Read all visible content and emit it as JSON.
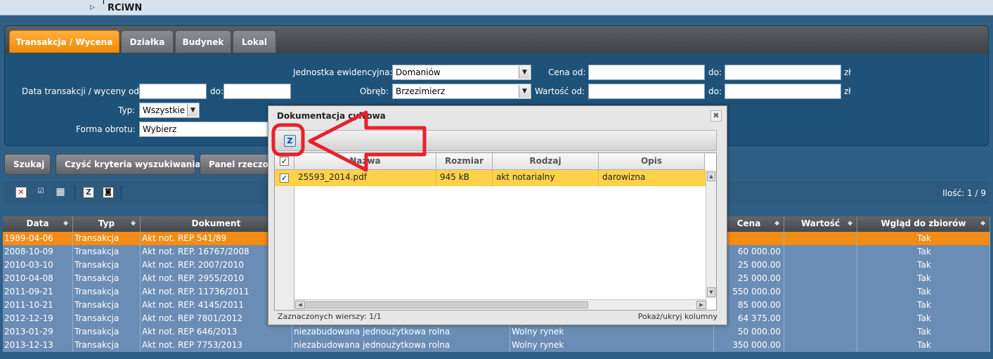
{
  "app": {
    "title": "RCiWN"
  },
  "tabs": [
    {
      "label": "Transakcja / Wycena",
      "active": true
    },
    {
      "label": "Działka",
      "active": false
    },
    {
      "label": "Budynek",
      "active": false
    },
    {
      "label": "Lokal",
      "active": false
    }
  ],
  "filters": {
    "jednostka_label": "Jednostka ewidencyjna:",
    "jednostka_value": "Domaniów",
    "obreb_label": "Obręb:",
    "obreb_value": "Brzezimierz",
    "cena_od_label": "Cena od:",
    "cena_do_label": "do:",
    "cena_unit": "zł",
    "wartosc_od_label": "Wartość od:",
    "wartosc_do_label": "do:",
    "wartosc_unit": "zł",
    "data_label": "Data transakcji / wyceny od:",
    "data_do_label": "do:",
    "typ_label": "Typ:",
    "typ_value": "Wszystkie",
    "forma_label": "Forma obrotu:",
    "forma_value": "Wybierz"
  },
  "buttons": {
    "search": "Szukaj",
    "clear": "Czyść kryteria wyszukiwania",
    "panel": "Panel rzeczoz"
  },
  "toolbar": {
    "count_label": "Ilość: 1 / 9"
  },
  "grid": {
    "columns": [
      "Data",
      "Typ",
      "Dokument",
      "Cena",
      "Wartość",
      "Wgląd do zbiorów"
    ],
    "rows": [
      {
        "data": "1989-04-06",
        "typ": "Transakcja",
        "dokument": "Akt not. REP 541/89",
        "opis": "",
        "rynek": "",
        "cena": "",
        "wartosc": "",
        "wglad": "Tak",
        "selected": true
      },
      {
        "data": "2008-10-09",
        "typ": "Transakcja",
        "dokument": "Akt not. REP. 16767/2008",
        "opis": "",
        "rynek": "",
        "cena": "60 000.00",
        "wartosc": "",
        "wglad": "Tak",
        "selected": false
      },
      {
        "data": "2010-03-10",
        "typ": "Transakcja",
        "dokument": "Akt not. REP. 2007/2010",
        "opis": "",
        "rynek": "",
        "cena": "25 000.00",
        "wartosc": "",
        "wglad": "Tak",
        "selected": false
      },
      {
        "data": "2010-04-08",
        "typ": "Transakcja",
        "dokument": "Akt not. REP. 2955/2010",
        "opis": "",
        "rynek": "",
        "cena": "25 000.00",
        "wartosc": "",
        "wglad": "Tak",
        "selected": false
      },
      {
        "data": "2011-09-21",
        "typ": "Transakcja",
        "dokument": "Akt not. REP. 11736/2011",
        "opis": "",
        "rynek": "",
        "cena": "550 000.00",
        "wartosc": "",
        "wglad": "Tak",
        "selected": false
      },
      {
        "data": "2011-10-21",
        "typ": "Transakcja",
        "dokument": "Akt not. REP. 4145/2011",
        "opis": "",
        "rynek": "",
        "cena": "85 000.00",
        "wartosc": "",
        "wglad": "Tak",
        "selected": false
      },
      {
        "data": "2012-12-19",
        "typ": "Transakcja",
        "dokument": "Akt not. REP 7801/2012",
        "opis": "",
        "rynek": "",
        "cena": "64 375.00",
        "wartosc": "",
        "wglad": "Tak",
        "selected": false
      },
      {
        "data": "2013-01-29",
        "typ": "Transakcja",
        "dokument": "Akt not. REP 646/2013",
        "opis": "niezabudowana jednoużytkowa rolna",
        "rynek": "Wolny rynek",
        "cena": "50 000.00",
        "wartosc": "",
        "wglad": "Tak",
        "selected": false
      },
      {
        "data": "2013-12-13",
        "typ": "Transakcja",
        "dokument": "Akt not. REP 7753/2013",
        "opis": "niezabudowana jednoużytkowa rolna",
        "rynek": "Wolny rynek",
        "cena": "350 000.00",
        "wartosc": "",
        "wglad": "Tak",
        "selected": false
      }
    ]
  },
  "modal": {
    "title": "Dokumentacja cyfrowa",
    "close_icon": "✖",
    "columns": [
      "Nazwa",
      "Rozmiar",
      "Rodzaj",
      "Opis"
    ],
    "rows": [
      {
        "nazwa": "25593_2014.pdf",
        "rozmiar": "945 kB",
        "rodzaj": "akt notarialny",
        "opis": "darowizna",
        "checked": true
      }
    ],
    "footer_left": "Zaznaczonych wierszy: 1/1",
    "footer_right": "Pokaż/ukryj kolumny"
  },
  "colors": {
    "accent": "#ef8a00",
    "panel": "#1f5278",
    "row": "#6a8db5",
    "annotation": "#e8212b"
  }
}
